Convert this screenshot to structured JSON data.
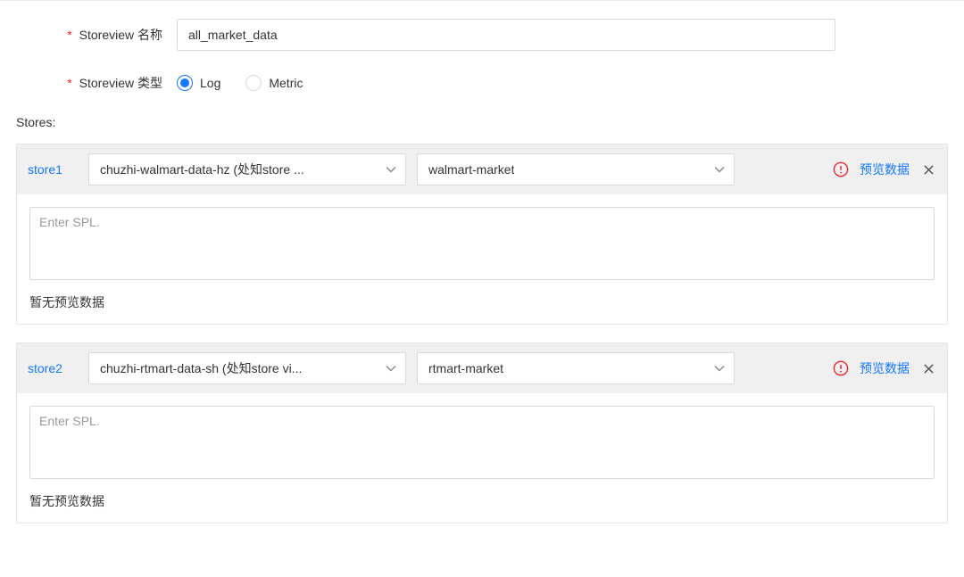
{
  "form": {
    "name_label": "Storeview 名称",
    "name_value": "all_market_data",
    "type_label": "Storeview 类型",
    "type_options": {
      "log": "Log",
      "metric": "Metric"
    },
    "type_selected": "log"
  },
  "stores_label": "Stores:",
  "stores": [
    {
      "name": "store1",
      "project_select": "chuzhi-walmart-data-hz (处知store ...",
      "store_select": "walmart-market",
      "preview_label": "预览数据",
      "spl_placeholder": "Enter SPL.",
      "spl_value": "",
      "no_preview_text": "暂无预览数据"
    },
    {
      "name": "store2",
      "project_select": "chuzhi-rtmart-data-sh (处知store vi...",
      "store_select": "rtmart-market",
      "preview_label": "预览数据",
      "spl_placeholder": "Enter SPL.",
      "spl_value": "",
      "no_preview_text": "暂无预览数据"
    }
  ]
}
